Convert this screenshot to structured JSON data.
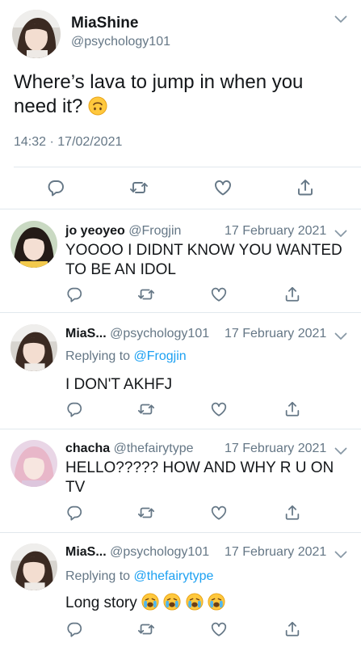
{
  "main_tweet": {
    "display_name": "MiaShine",
    "handle": "@psychology101",
    "text": "Where’s lava to jump in when you need it?",
    "emoji": "upside-down-face",
    "time": "14:32",
    "separator": "·",
    "date": "17/02/2021"
  },
  "replies": [
    {
      "display_name": "jo yeoyeo",
      "handle": "@Frogjin",
      "date": "17 February 2021",
      "line1": "YOOOO I DIDNT KNOW YOU WANTED",
      "line2": "TO BE AN IDOL"
    },
    {
      "display_name": "MiaS...",
      "handle": "@psychology101",
      "date": "17 February 2021",
      "replying_prefix": "Replying to",
      "replying_to": "@Frogjin",
      "text": "I DON'T AKHFJ"
    },
    {
      "display_name": "chacha",
      "handle": "@thefairytype",
      "date": "17 February 2021",
      "line1": "HELLO????? HOW AND WHY R U ON",
      "line2": "TV"
    },
    {
      "display_name": "MiaS...",
      "handle": "@psychology101",
      "date": "17 February 2021",
      "replying_prefix": "Replying to",
      "replying_to": "@thefairytype",
      "text": "Long story",
      "emojis": [
        "loudly-crying-face",
        "loudly-crying-face",
        "loudly-crying-face",
        "loudly-crying-face"
      ]
    }
  ],
  "icons": {
    "reply": "reply-icon",
    "retweet": "retweet-icon",
    "like": "heart-icon",
    "share": "share-icon",
    "more": "chevron-down-icon"
  },
  "colors": {
    "text": "#14171a",
    "muted": "#657786",
    "link": "#1da1f2",
    "divider": "#e1e8ed",
    "emoji": "#ffc83d"
  }
}
